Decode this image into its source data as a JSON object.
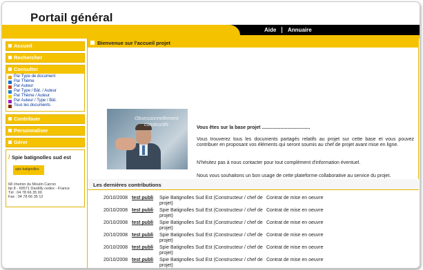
{
  "header": {
    "title": "Portail général",
    "links": [
      "Aide",
      "Annuaire"
    ]
  },
  "nav": {
    "accueil": "Accueil",
    "rechercher": "Rechercher",
    "consulter": "Consulter",
    "consulter_items": [
      {
        "label": "Par Type de document",
        "color": "#e8a000"
      },
      {
        "label": "Par Thème",
        "color": "#1e6fc8"
      },
      {
        "label": "Par Auteur",
        "color": "#d23b1e"
      },
      {
        "label": "Par Type / Bât. / Auteur",
        "color": "#2f7fc0"
      },
      {
        "label": "Par Thème / Auteur",
        "color": "#f0d000"
      },
      {
        "label": "Par Auteur / Type / Bât.",
        "color": "#a020c0"
      },
      {
        "label": "Tous les documents",
        "color": "#8a2a10"
      }
    ],
    "contribuer": "Contribuer",
    "personnaliser": "Personnaliser",
    "gerer": "Gérer"
  },
  "company": {
    "name": "Spie batignolles sud est",
    "logo_text": "spie batignolles",
    "address": [
      "68 chemin du Moulin Carron",
      "bp 8 - 69571 Dardilly cedex - France",
      "Tél : 04 78 66 35 00",
      "Fax : 04 78 66 35 12"
    ]
  },
  "welcome": {
    "title": "Bienvenue sur l'accueil projet",
    "photo_text": [
      "Obsessionnellement",
      "constructifs"
    ],
    "heading": "Vous êtes sur la base projet ....................................",
    "p1": "Vous trouverez tous les documents partagés relatifs au projet sur cette base et vous pouvez contribuer en proposant vos éléments qui seront soumis au chef de projet avant mise en ligne.",
    "p2": "N'hésitez pas à nous contacter pour tout complément d'information éventuel.",
    "p3": "Nous vous souhaitons un bon usage de cette plateforme collaborative au service du projet."
  },
  "contributions": {
    "title": "Les dernières contributions",
    "rows": [
      {
        "date": "20/10/2008",
        "link": "test publi",
        "author": "Spie Batignolles Sud Est (Constructeur / chef de projet)",
        "type": "Contrat de mise en oeuvre"
      },
      {
        "date": "20/10/2008",
        "link": "test publi",
        "author": "Spie Batignolles Sud Est (Constructeur / chef de projet)",
        "type": "Contrat de mise en oeuvre"
      },
      {
        "date": "20/10/2008",
        "link": "test publi",
        "author": "Spie Batignolles Sud Est (Constructeur / chef de projet)",
        "type": "Contrat de mise en oeuvre"
      },
      {
        "date": "20/10/2008",
        "link": "test publi",
        "author": "Spie Batignolles Sud Est (Constructeur / chef de projet)",
        "type": "Contrat de mise en oeuvre"
      },
      {
        "date": "20/10/2008",
        "link": "test publi",
        "author": "Spie Batignolles Sud Est (Constructeur / chef de projet)",
        "type": "Contrat de mise en oeuvre"
      },
      {
        "date": "20/10/2008",
        "link": "test publi",
        "author": "Spie Batignolles Sud Est (Constructeur / chef de projet)",
        "type": "Contrat de mise en oeuvre"
      }
    ]
  },
  "colors": {
    "accent": "#f5c200",
    "topbar": "#000000"
  }
}
